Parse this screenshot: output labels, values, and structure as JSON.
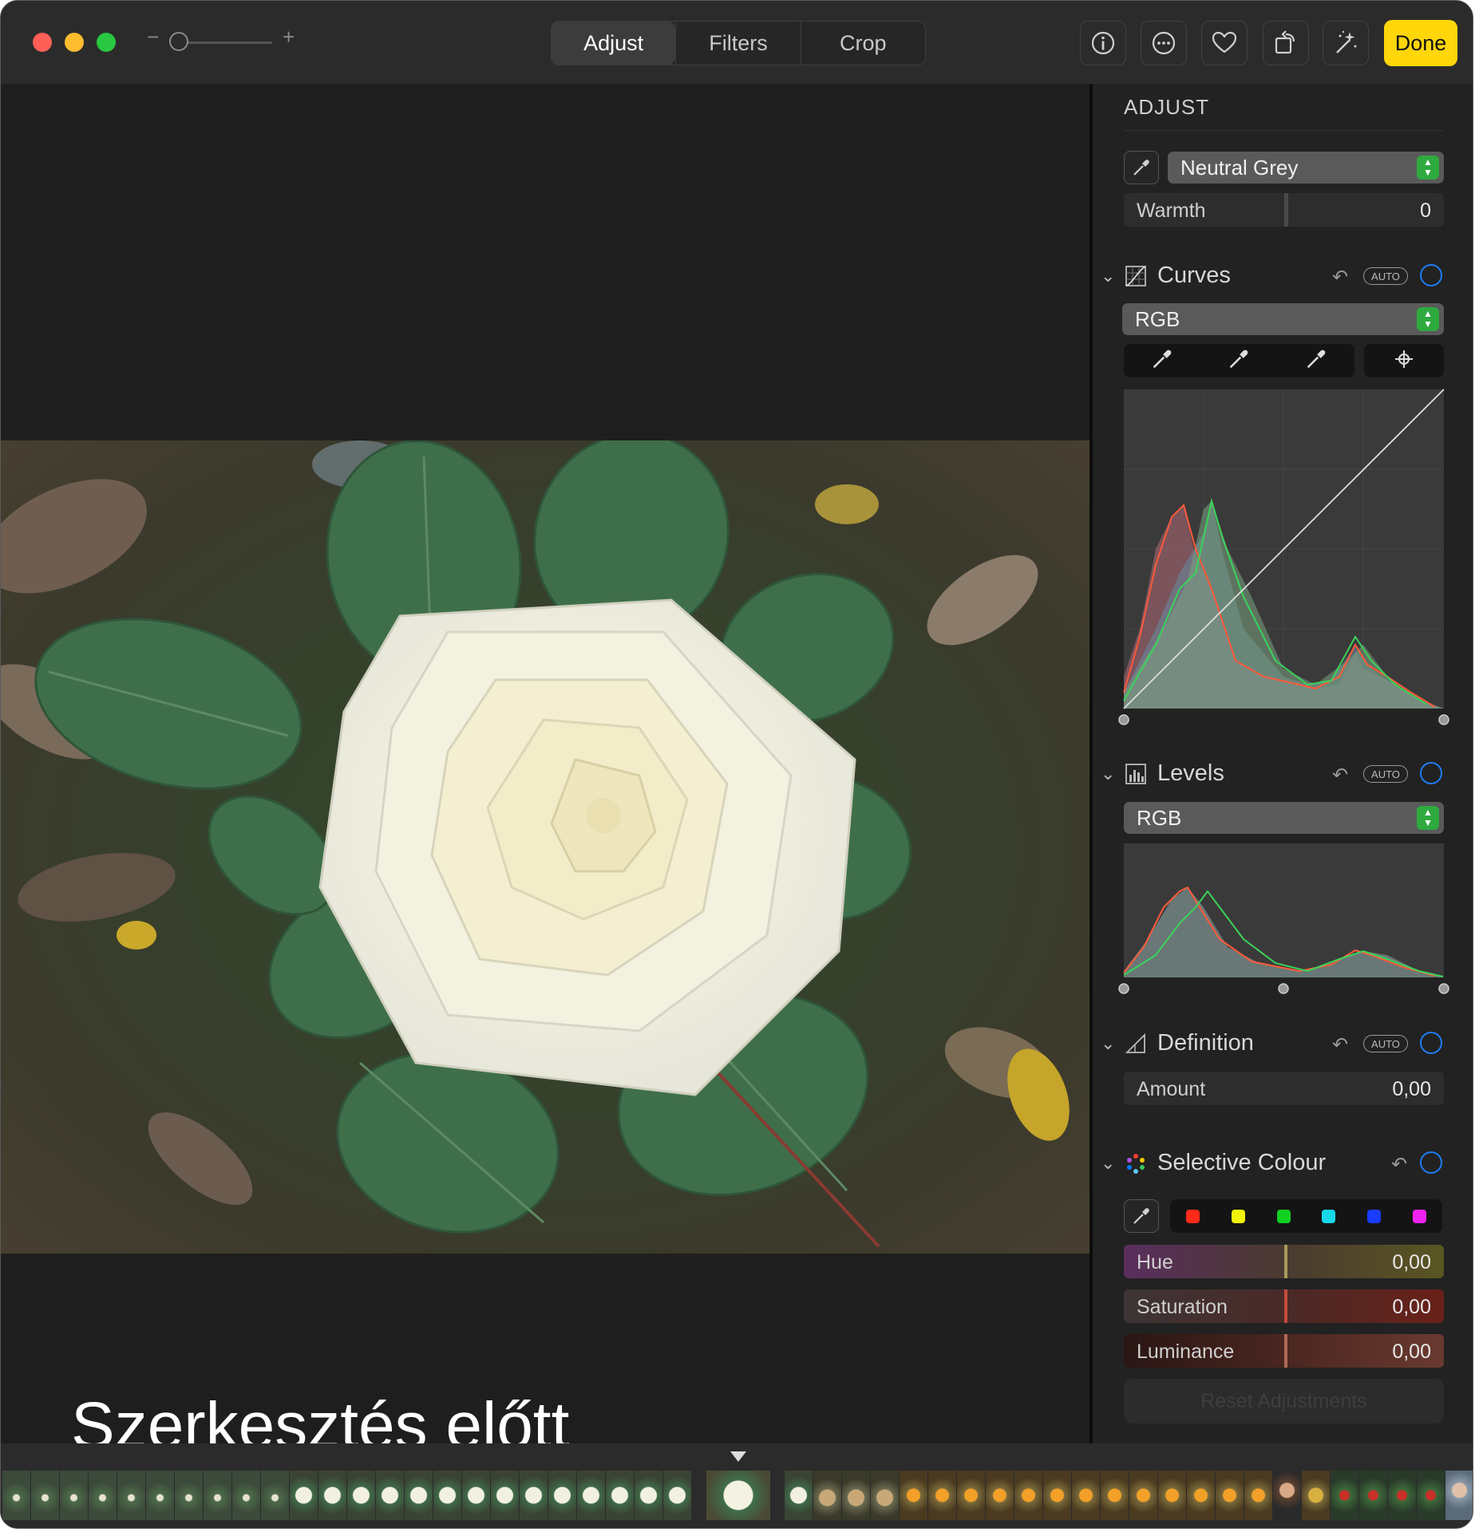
{
  "toolbar": {
    "zoom_minus": "−",
    "zoom_plus": "+",
    "tabs": [
      {
        "label": "Adjust",
        "active": true
      },
      {
        "label": "Filters",
        "active": false
      },
      {
        "label": "Crop",
        "active": false
      }
    ],
    "icons": [
      "info-icon",
      "more-icon",
      "heart-icon",
      "rotate-icon",
      "magic-wand-icon"
    ],
    "done_label": "Done"
  },
  "canvas": {
    "caption": "Szerkesztés előtt"
  },
  "panel": {
    "title": "ADJUST",
    "white_balance": {
      "mode": "Neutral Grey",
      "warmth_label": "Warmth",
      "warmth_value": "0"
    },
    "curves": {
      "title": "Curves",
      "auto_label": "AUTO",
      "channel": "RGB"
    },
    "levels": {
      "title": "Levels",
      "auto_label": "AUTO",
      "channel": "RGB"
    },
    "definition": {
      "title": "Definition",
      "auto_label": "AUTO",
      "amount_label": "Amount",
      "amount_value": "0,00"
    },
    "selective_colour": {
      "title": "Selective Colour",
      "swatches": [
        "#ff2a1a",
        "#f2f20a",
        "#10d020",
        "#15d8e8",
        "#1a3cff",
        "#ee22ee"
      ],
      "hue_label": "Hue",
      "hue_value": "0,00",
      "saturation_label": "Saturation",
      "saturation_value": "0,00",
      "luminance_label": "Luminance",
      "luminance_value": "0,00"
    },
    "reset_label": "Reset Adjustments"
  }
}
